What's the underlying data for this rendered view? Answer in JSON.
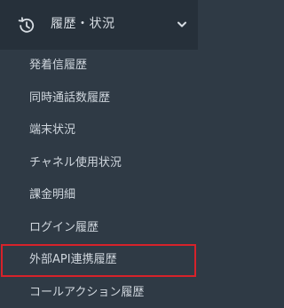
{
  "section": {
    "title": "履歴・状況",
    "icon": "history-icon",
    "toggle_icon": "chevron-down-icon"
  },
  "menu": {
    "items": [
      {
        "label": "発着信履歴"
      },
      {
        "label": "同時通話数履歴"
      },
      {
        "label": "端末状況"
      },
      {
        "label": "チャネル使用状況"
      },
      {
        "label": "課金明細"
      },
      {
        "label": "ログイン履歴"
      },
      {
        "label": "外部API連携履歴",
        "highlighted": true
      },
      {
        "label": "コールアクション履歴"
      }
    ]
  },
  "colors": {
    "background": "#2f3a45",
    "header_background": "#26303a",
    "text": "#cfd6dd",
    "highlight_border": "#d7222a"
  }
}
